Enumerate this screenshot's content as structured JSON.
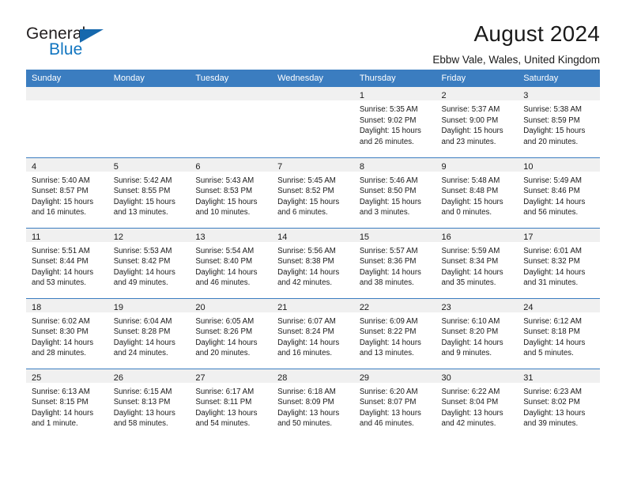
{
  "brand": {
    "name_top": "General",
    "name_bottom": "Blue",
    "accent_color": "#1175c0",
    "triangle_color": "#1668ad"
  },
  "header": {
    "title": "August 2024",
    "subtitle": "Ebbw Vale, Wales, United Kingdom"
  },
  "theme": {
    "header_row_bg": "#3b7dc0",
    "daynum_band_bg": "#f0f0f0",
    "text_color": "#1a1a1a"
  },
  "weekday_headers": [
    "Sunday",
    "Monday",
    "Tuesday",
    "Wednesday",
    "Thursday",
    "Friday",
    "Saturday"
  ],
  "weeks": [
    [
      {
        "day": "",
        "empty": true
      },
      {
        "day": "",
        "empty": true
      },
      {
        "day": "",
        "empty": true
      },
      {
        "day": "",
        "empty": true
      },
      {
        "day": "1",
        "sunrise": "Sunrise: 5:35 AM",
        "sunset": "Sunset: 9:02 PM",
        "daylight_1": "Daylight: 15 hours",
        "daylight_2": "and 26 minutes."
      },
      {
        "day": "2",
        "sunrise": "Sunrise: 5:37 AM",
        "sunset": "Sunset: 9:00 PM",
        "daylight_1": "Daylight: 15 hours",
        "daylight_2": "and 23 minutes."
      },
      {
        "day": "3",
        "sunrise": "Sunrise: 5:38 AM",
        "sunset": "Sunset: 8:59 PM",
        "daylight_1": "Daylight: 15 hours",
        "daylight_2": "and 20 minutes."
      }
    ],
    [
      {
        "day": "4",
        "sunrise": "Sunrise: 5:40 AM",
        "sunset": "Sunset: 8:57 PM",
        "daylight_1": "Daylight: 15 hours",
        "daylight_2": "and 16 minutes."
      },
      {
        "day": "5",
        "sunrise": "Sunrise: 5:42 AM",
        "sunset": "Sunset: 8:55 PM",
        "daylight_1": "Daylight: 15 hours",
        "daylight_2": "and 13 minutes."
      },
      {
        "day": "6",
        "sunrise": "Sunrise: 5:43 AM",
        "sunset": "Sunset: 8:53 PM",
        "daylight_1": "Daylight: 15 hours",
        "daylight_2": "and 10 minutes."
      },
      {
        "day": "7",
        "sunrise": "Sunrise: 5:45 AM",
        "sunset": "Sunset: 8:52 PM",
        "daylight_1": "Daylight: 15 hours",
        "daylight_2": "and 6 minutes."
      },
      {
        "day": "8",
        "sunrise": "Sunrise: 5:46 AM",
        "sunset": "Sunset: 8:50 PM",
        "daylight_1": "Daylight: 15 hours",
        "daylight_2": "and 3 minutes."
      },
      {
        "day": "9",
        "sunrise": "Sunrise: 5:48 AM",
        "sunset": "Sunset: 8:48 PM",
        "daylight_1": "Daylight: 15 hours",
        "daylight_2": "and 0 minutes."
      },
      {
        "day": "10",
        "sunrise": "Sunrise: 5:49 AM",
        "sunset": "Sunset: 8:46 PM",
        "daylight_1": "Daylight: 14 hours",
        "daylight_2": "and 56 minutes."
      }
    ],
    [
      {
        "day": "11",
        "sunrise": "Sunrise: 5:51 AM",
        "sunset": "Sunset: 8:44 PM",
        "daylight_1": "Daylight: 14 hours",
        "daylight_2": "and 53 minutes."
      },
      {
        "day": "12",
        "sunrise": "Sunrise: 5:53 AM",
        "sunset": "Sunset: 8:42 PM",
        "daylight_1": "Daylight: 14 hours",
        "daylight_2": "and 49 minutes."
      },
      {
        "day": "13",
        "sunrise": "Sunrise: 5:54 AM",
        "sunset": "Sunset: 8:40 PM",
        "daylight_1": "Daylight: 14 hours",
        "daylight_2": "and 46 minutes."
      },
      {
        "day": "14",
        "sunrise": "Sunrise: 5:56 AM",
        "sunset": "Sunset: 8:38 PM",
        "daylight_1": "Daylight: 14 hours",
        "daylight_2": "and 42 minutes."
      },
      {
        "day": "15",
        "sunrise": "Sunrise: 5:57 AM",
        "sunset": "Sunset: 8:36 PM",
        "daylight_1": "Daylight: 14 hours",
        "daylight_2": "and 38 minutes."
      },
      {
        "day": "16",
        "sunrise": "Sunrise: 5:59 AM",
        "sunset": "Sunset: 8:34 PM",
        "daylight_1": "Daylight: 14 hours",
        "daylight_2": "and 35 minutes."
      },
      {
        "day": "17",
        "sunrise": "Sunrise: 6:01 AM",
        "sunset": "Sunset: 8:32 PM",
        "daylight_1": "Daylight: 14 hours",
        "daylight_2": "and 31 minutes."
      }
    ],
    [
      {
        "day": "18",
        "sunrise": "Sunrise: 6:02 AM",
        "sunset": "Sunset: 8:30 PM",
        "daylight_1": "Daylight: 14 hours",
        "daylight_2": "and 28 minutes."
      },
      {
        "day": "19",
        "sunrise": "Sunrise: 6:04 AM",
        "sunset": "Sunset: 8:28 PM",
        "daylight_1": "Daylight: 14 hours",
        "daylight_2": "and 24 minutes."
      },
      {
        "day": "20",
        "sunrise": "Sunrise: 6:05 AM",
        "sunset": "Sunset: 8:26 PM",
        "daylight_1": "Daylight: 14 hours",
        "daylight_2": "and 20 minutes."
      },
      {
        "day": "21",
        "sunrise": "Sunrise: 6:07 AM",
        "sunset": "Sunset: 8:24 PM",
        "daylight_1": "Daylight: 14 hours",
        "daylight_2": "and 16 minutes."
      },
      {
        "day": "22",
        "sunrise": "Sunrise: 6:09 AM",
        "sunset": "Sunset: 8:22 PM",
        "daylight_1": "Daylight: 14 hours",
        "daylight_2": "and 13 minutes."
      },
      {
        "day": "23",
        "sunrise": "Sunrise: 6:10 AM",
        "sunset": "Sunset: 8:20 PM",
        "daylight_1": "Daylight: 14 hours",
        "daylight_2": "and 9 minutes."
      },
      {
        "day": "24",
        "sunrise": "Sunrise: 6:12 AM",
        "sunset": "Sunset: 8:18 PM",
        "daylight_1": "Daylight: 14 hours",
        "daylight_2": "and 5 minutes."
      }
    ],
    [
      {
        "day": "25",
        "sunrise": "Sunrise: 6:13 AM",
        "sunset": "Sunset: 8:15 PM",
        "daylight_1": "Daylight: 14 hours",
        "daylight_2": "and 1 minute."
      },
      {
        "day": "26",
        "sunrise": "Sunrise: 6:15 AM",
        "sunset": "Sunset: 8:13 PM",
        "daylight_1": "Daylight: 13 hours",
        "daylight_2": "and 58 minutes."
      },
      {
        "day": "27",
        "sunrise": "Sunrise: 6:17 AM",
        "sunset": "Sunset: 8:11 PM",
        "daylight_1": "Daylight: 13 hours",
        "daylight_2": "and 54 minutes."
      },
      {
        "day": "28",
        "sunrise": "Sunrise: 6:18 AM",
        "sunset": "Sunset: 8:09 PM",
        "daylight_1": "Daylight: 13 hours",
        "daylight_2": "and 50 minutes."
      },
      {
        "day": "29",
        "sunrise": "Sunrise: 6:20 AM",
        "sunset": "Sunset: 8:07 PM",
        "daylight_1": "Daylight: 13 hours",
        "daylight_2": "and 46 minutes."
      },
      {
        "day": "30",
        "sunrise": "Sunrise: 6:22 AM",
        "sunset": "Sunset: 8:04 PM",
        "daylight_1": "Daylight: 13 hours",
        "daylight_2": "and 42 minutes."
      },
      {
        "day": "31",
        "sunrise": "Sunrise: 6:23 AM",
        "sunset": "Sunset: 8:02 PM",
        "daylight_1": "Daylight: 13 hours",
        "daylight_2": "and 39 minutes."
      }
    ]
  ]
}
